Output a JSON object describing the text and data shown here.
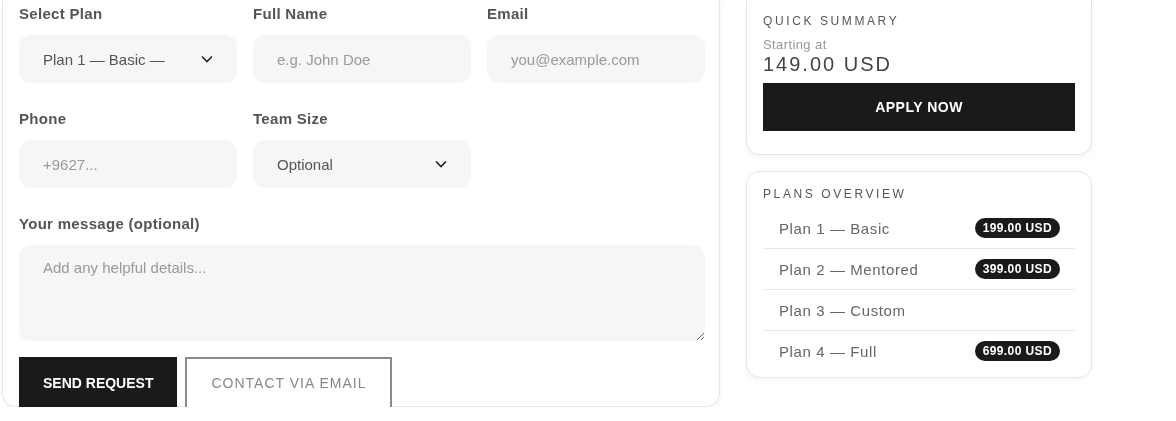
{
  "form": {
    "fields": [
      {
        "kind": "select",
        "label": "Select Plan",
        "value": "Plan 1 — Basic —"
      },
      {
        "kind": "input",
        "label": "Full Name",
        "placeholder": "e.g. John Doe"
      },
      {
        "kind": "input",
        "label": "Email",
        "placeholder": "you@example.com"
      },
      {
        "kind": "input",
        "label": "Phone",
        "placeholder": "+9627..."
      },
      {
        "kind": "select",
        "label": "Team Size",
        "value": "Optional"
      },
      {
        "kind": "textarea",
        "label": "Your message (optional)",
        "placeholder": "Add any helpful details..."
      }
    ],
    "buttons": [
      {
        "kind": "primary",
        "label": "SEND REQUEST"
      },
      {
        "kind": "outline",
        "label": "CONTACT VIA EMAIL"
      }
    ]
  },
  "summary": {
    "title": "QUICK SUMMARY",
    "caption": "Starting at",
    "price": "149.00 USD",
    "button": "APPLY NOW"
  },
  "plans_overview": {
    "title": "PLANS OVERVIEW",
    "plans": [
      {
        "name": "Plan 1 — Basic",
        "price": "199.00 USD"
      },
      {
        "name": "Plan 2 — Mentored",
        "price": "399.00 USD"
      },
      {
        "name": "Plan 3 — Custom"
      },
      {
        "name": "Plan 4 — Full",
        "price": "699.00 USD"
      }
    ]
  }
}
